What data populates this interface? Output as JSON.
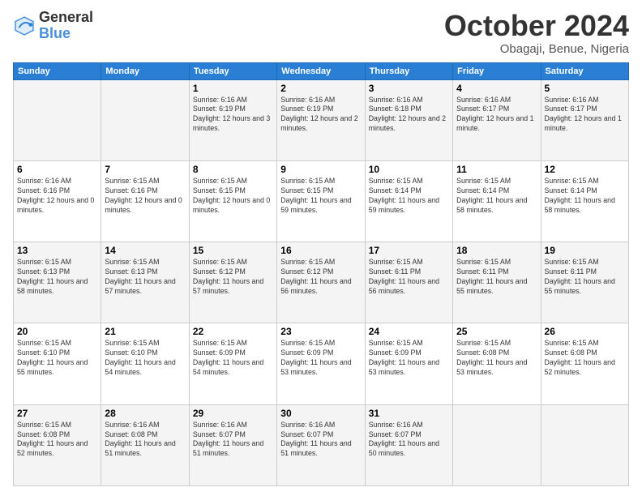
{
  "header": {
    "logo_general": "General",
    "logo_blue": "Blue",
    "month_title": "October 2024",
    "subtitle": "Obagaji, Benue, Nigeria"
  },
  "days_of_week": [
    "Sunday",
    "Monday",
    "Tuesday",
    "Wednesday",
    "Thursday",
    "Friday",
    "Saturday"
  ],
  "weeks": [
    [
      {
        "day": "",
        "info": ""
      },
      {
        "day": "",
        "info": ""
      },
      {
        "day": "1",
        "info": "Sunrise: 6:16 AM\nSunset: 6:19 PM\nDaylight: 12 hours and 3 minutes."
      },
      {
        "day": "2",
        "info": "Sunrise: 6:16 AM\nSunset: 6:19 PM\nDaylight: 12 hours and 2 minutes."
      },
      {
        "day": "3",
        "info": "Sunrise: 6:16 AM\nSunset: 6:18 PM\nDaylight: 12 hours and 2 minutes."
      },
      {
        "day": "4",
        "info": "Sunrise: 6:16 AM\nSunset: 6:17 PM\nDaylight: 12 hours and 1 minute."
      },
      {
        "day": "5",
        "info": "Sunrise: 6:16 AM\nSunset: 6:17 PM\nDaylight: 12 hours and 1 minute."
      }
    ],
    [
      {
        "day": "6",
        "info": "Sunrise: 6:16 AM\nSunset: 6:16 PM\nDaylight: 12 hours and 0 minutes."
      },
      {
        "day": "7",
        "info": "Sunrise: 6:15 AM\nSunset: 6:16 PM\nDaylight: 12 hours and 0 minutes."
      },
      {
        "day": "8",
        "info": "Sunrise: 6:15 AM\nSunset: 6:15 PM\nDaylight: 12 hours and 0 minutes."
      },
      {
        "day": "9",
        "info": "Sunrise: 6:15 AM\nSunset: 6:15 PM\nDaylight: 11 hours and 59 minutes."
      },
      {
        "day": "10",
        "info": "Sunrise: 6:15 AM\nSunset: 6:14 PM\nDaylight: 11 hours and 59 minutes."
      },
      {
        "day": "11",
        "info": "Sunrise: 6:15 AM\nSunset: 6:14 PM\nDaylight: 11 hours and 58 minutes."
      },
      {
        "day": "12",
        "info": "Sunrise: 6:15 AM\nSunset: 6:14 PM\nDaylight: 11 hours and 58 minutes."
      }
    ],
    [
      {
        "day": "13",
        "info": "Sunrise: 6:15 AM\nSunset: 6:13 PM\nDaylight: 11 hours and 58 minutes."
      },
      {
        "day": "14",
        "info": "Sunrise: 6:15 AM\nSunset: 6:13 PM\nDaylight: 11 hours and 57 minutes."
      },
      {
        "day": "15",
        "info": "Sunrise: 6:15 AM\nSunset: 6:12 PM\nDaylight: 11 hours and 57 minutes."
      },
      {
        "day": "16",
        "info": "Sunrise: 6:15 AM\nSunset: 6:12 PM\nDaylight: 11 hours and 56 minutes."
      },
      {
        "day": "17",
        "info": "Sunrise: 6:15 AM\nSunset: 6:11 PM\nDaylight: 11 hours and 56 minutes."
      },
      {
        "day": "18",
        "info": "Sunrise: 6:15 AM\nSunset: 6:11 PM\nDaylight: 11 hours and 55 minutes."
      },
      {
        "day": "19",
        "info": "Sunrise: 6:15 AM\nSunset: 6:11 PM\nDaylight: 11 hours and 55 minutes."
      }
    ],
    [
      {
        "day": "20",
        "info": "Sunrise: 6:15 AM\nSunset: 6:10 PM\nDaylight: 11 hours and 55 minutes."
      },
      {
        "day": "21",
        "info": "Sunrise: 6:15 AM\nSunset: 6:10 PM\nDaylight: 11 hours and 54 minutes."
      },
      {
        "day": "22",
        "info": "Sunrise: 6:15 AM\nSunset: 6:09 PM\nDaylight: 11 hours and 54 minutes."
      },
      {
        "day": "23",
        "info": "Sunrise: 6:15 AM\nSunset: 6:09 PM\nDaylight: 11 hours and 53 minutes."
      },
      {
        "day": "24",
        "info": "Sunrise: 6:15 AM\nSunset: 6:09 PM\nDaylight: 11 hours and 53 minutes."
      },
      {
        "day": "25",
        "info": "Sunrise: 6:15 AM\nSunset: 6:08 PM\nDaylight: 11 hours and 53 minutes."
      },
      {
        "day": "26",
        "info": "Sunrise: 6:15 AM\nSunset: 6:08 PM\nDaylight: 11 hours and 52 minutes."
      }
    ],
    [
      {
        "day": "27",
        "info": "Sunrise: 6:15 AM\nSunset: 6:08 PM\nDaylight: 11 hours and 52 minutes."
      },
      {
        "day": "28",
        "info": "Sunrise: 6:16 AM\nSunset: 6:08 PM\nDaylight: 11 hours and 51 minutes."
      },
      {
        "day": "29",
        "info": "Sunrise: 6:16 AM\nSunset: 6:07 PM\nDaylight: 11 hours and 51 minutes."
      },
      {
        "day": "30",
        "info": "Sunrise: 6:16 AM\nSunset: 6:07 PM\nDaylight: 11 hours and 51 minutes."
      },
      {
        "day": "31",
        "info": "Sunrise: 6:16 AM\nSunset: 6:07 PM\nDaylight: 11 hours and 50 minutes."
      },
      {
        "day": "",
        "info": ""
      },
      {
        "day": "",
        "info": ""
      }
    ]
  ]
}
